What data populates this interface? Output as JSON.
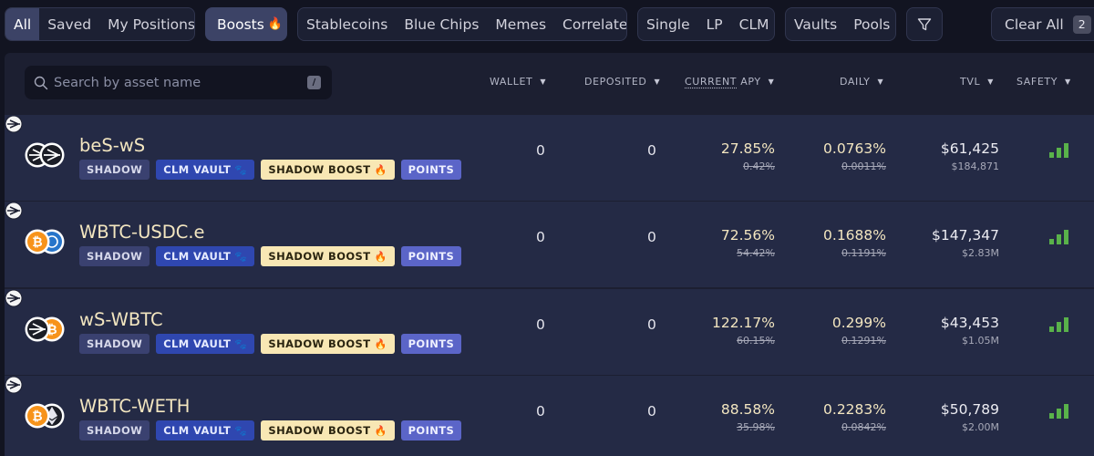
{
  "filters": {
    "group1": [
      "All",
      "Saved",
      "My Positions"
    ],
    "boosts": "Boosts",
    "group3": [
      "Stablecoins",
      "Blue Chips",
      "Memes",
      "Correlated"
    ],
    "group4": [
      "Single",
      "LP",
      "CLM"
    ],
    "group5": [
      "Vaults",
      "Pools"
    ],
    "clear_all": "Clear All",
    "clear_count": "2"
  },
  "search": {
    "placeholder": "Search by asset name",
    "shortcut": "/"
  },
  "columns": {
    "wallet": "WALLET",
    "deposited": "DEPOSITED",
    "current": "CURRENT",
    "apy": "APY",
    "daily": "DAILY",
    "tvl": "TVL",
    "safety": "SAFETY"
  },
  "tags": {
    "shadow": "SHADOW",
    "clm_vault": "CLM VAULT",
    "shadow_boost": "SHADOW BOOST",
    "points": "POINTS"
  },
  "rows": [
    {
      "name": "beS-wS",
      "wallet": "0",
      "deposited": "0",
      "apy": "27.85%",
      "apy_old": "0.42%",
      "daily": "0.0763%",
      "daily_old": "0.0011%",
      "tvl": "$61,425",
      "tvl_sub": "$184,871",
      "icons": [
        "sonic-icon",
        "sonic-icon"
      ]
    },
    {
      "name": "WBTC-USDC.e",
      "wallet": "0",
      "deposited": "0",
      "apy": "72.56%",
      "apy_old": "54.42%",
      "daily": "0.1688%",
      "daily_old": "0.1191%",
      "tvl": "$147,347",
      "tvl_sub": "$2.83M",
      "icons": [
        "bitcoin-icon",
        "usdc-icon"
      ]
    },
    {
      "name": "wS-WBTC",
      "wallet": "0",
      "deposited": "0",
      "apy": "122.17%",
      "apy_old": "60.15%",
      "daily": "0.299%",
      "daily_old": "0.1291%",
      "tvl": "$43,453",
      "tvl_sub": "$1.05M",
      "icons": [
        "sonic-icon",
        "bitcoin-icon"
      ]
    },
    {
      "name": "WBTC-WETH",
      "wallet": "0",
      "deposited": "0",
      "apy": "88.58%",
      "apy_old": "35.98%",
      "daily": "0.2283%",
      "daily_old": "0.0842%",
      "tvl": "$50,789",
      "tvl_sub": "$2.00M",
      "icons": [
        "bitcoin-icon",
        "ethereum-icon"
      ]
    }
  ],
  "colors": {
    "accent": "#3c4366",
    "safety": "#59b24a",
    "tag_boost": "#f8e7b4",
    "tag_clm": "#2f47b0"
  }
}
